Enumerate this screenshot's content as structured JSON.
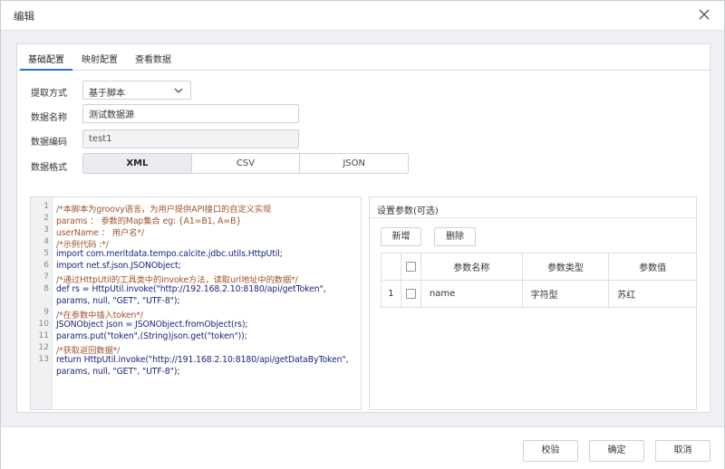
{
  "dialog": {
    "title": "编辑"
  },
  "tabs": [
    {
      "label": "基础配置",
      "active": true
    },
    {
      "label": "映射配置",
      "active": false
    },
    {
      "label": "查看数据",
      "active": false
    }
  ],
  "form": {
    "extract_label": "提取方式",
    "extract_value": "基于脚本",
    "name_label": "数据名称",
    "name_value": "测试数据源",
    "code_label": "数据编码",
    "code_value": "test1",
    "format_label": "数据格式",
    "formats": [
      "XML",
      "CSV",
      "JSON"
    ],
    "format_selected": "XML"
  },
  "editor": {
    "line_numbers": [
      "1",
      "2",
      "3",
      "4",
      "5",
      "6",
      "7",
      "8",
      "",
      "9",
      "10",
      "11",
      "12",
      "13",
      ""
    ],
    "lines": [
      "/*本脚本为groovy语言，为用户提供API接口的自定义实现",
      "params ：  参数的Map集合 eg: {A1=B1, A=B}",
      "userName   ：  用户名*/",
      "/*示例代码 :*/",
      "   import com.meritdata.tempo.calcite.jdbc.utils.HttpUtil;",
      "   import net.sf.json.JSONObject;",
      "   /*通过HttpUtil的工具类中的invoke方法，读取url地址中的数据*/",
      "   def rs = HttpUtil.invoke(\"http://192.168.2.10:8180/api/getToken\",",
      "params, null, \"GET\", \"UTF-8\");",
      "   /*在参数中插入token*/",
      "   JSONObject json = JSONObject.fromObject(rs);",
      "   params.put(\"token\",(String)json.get(\"token\"));",
      "   /*获取返回数据*/",
      "   return HttpUtil.invoke(\"http://191.168.2.10:8180/api/getDataByToken\",",
      "params, null, \"GET\", \"UTF-8\");"
    ]
  },
  "params_panel": {
    "title": "设置参数(可选)",
    "add_label": "新增",
    "delete_label": "删除",
    "columns": [
      "参数名称",
      "参数类型",
      "参数值"
    ],
    "rows": [
      {
        "index": "1",
        "name": "name",
        "type": "字符型",
        "value": "苏红"
      }
    ]
  },
  "footer": {
    "validate_label": "校验",
    "ok_label": "确定",
    "cancel_label": "取消"
  },
  "colors": {
    "accent": "#2b6fd6",
    "comment": "#a0522d",
    "keyword": "#7b1fa2",
    "string": "#1565c0"
  }
}
